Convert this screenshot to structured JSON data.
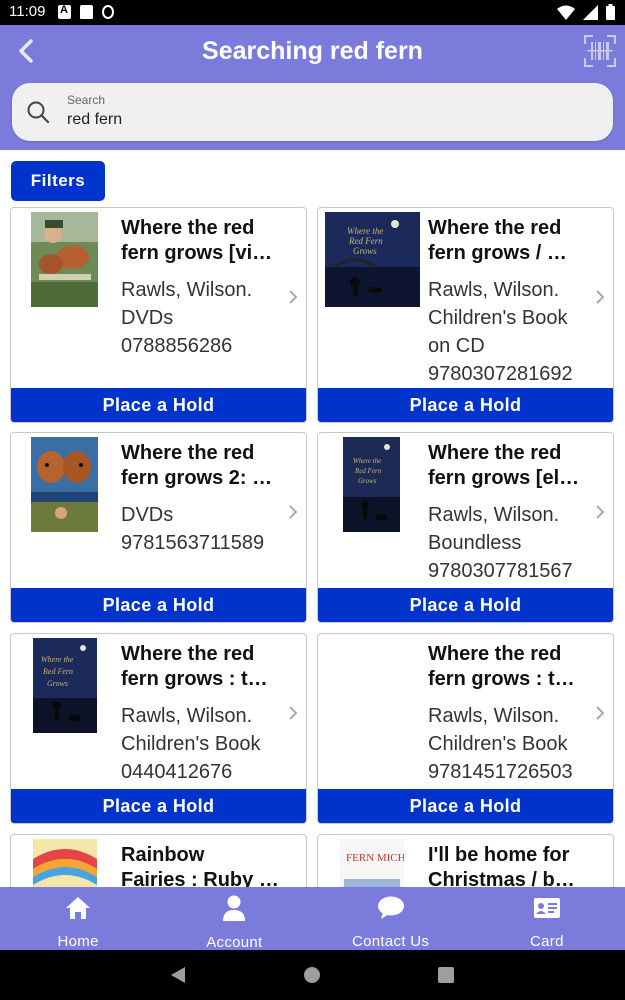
{
  "status_bar": {
    "time": "11:09"
  },
  "header": {
    "title": "Searching red fern",
    "search_label": "Search",
    "search_value": "red fern"
  },
  "filters_label": "Filters",
  "results": [
    {
      "title_line1": "Where the red",
      "title_line2": "fern grows [vi…",
      "meta": [
        "Rawls, Wilson.",
        "DVDs",
        "0788856286"
      ],
      "hold_label": "Place a Hold",
      "cover": "cover-boy-dogs"
    },
    {
      "title_line1": "Where the red",
      "title_line2": "fern grows / …",
      "meta": [
        "Rawls, Wilson.",
        "Children's Book",
        "on CD",
        "9780307281692"
      ],
      "hold_label": "Place a Hold",
      "cover": "cover-night-blue"
    },
    {
      "title_line1": "Where the red",
      "title_line2": "fern grows 2: …",
      "meta": [
        "DVDs",
        "9781563711589"
      ],
      "hold_label": "Place a Hold",
      "cover": "cover-dogs-2"
    },
    {
      "title_line1": "Where the red",
      "title_line2": "fern grows [el…",
      "meta": [
        "Rawls, Wilson.",
        "Boundless",
        "9780307781567"
      ],
      "hold_label": "Place a Hold",
      "cover": "cover-night-blue"
    },
    {
      "title_line1": "Where the red",
      "title_line2": "fern grows : t…",
      "meta": [
        "Rawls, Wilson.",
        "Children's Book",
        "0440412676"
      ],
      "hold_label": "Place a Hold",
      "cover": "cover-night-blue"
    },
    {
      "title_line1": "Where the red",
      "title_line2": "fern grows : t…",
      "meta": [
        "Rawls, Wilson.",
        "Children's Book",
        "9781451726503"
      ],
      "hold_label": "Place a Hold",
      "cover": "none"
    },
    {
      "title_line1": "Rainbow",
      "title_line2": "Fairies : Ruby …",
      "meta": [],
      "hold_label": "",
      "cover": "cover-rainbow"
    },
    {
      "title_line1": "I'll be home for",
      "title_line2": "Christmas / b…",
      "meta": [],
      "hold_label": "",
      "cover": "cover-fern-michaels"
    }
  ],
  "covers_text": {
    "fern_michaels": "FERN MICHAELS"
  },
  "bottom_nav": [
    {
      "label": "Home",
      "icon": "home-icon"
    },
    {
      "label": "Account",
      "icon": "person-icon"
    },
    {
      "label": "Contact Us",
      "icon": "chat-bubble-icon"
    },
    {
      "label": "Card",
      "icon": "id-card-icon"
    }
  ],
  "colors": {
    "header": "#7b7bdc",
    "button": "#0033cc"
  }
}
